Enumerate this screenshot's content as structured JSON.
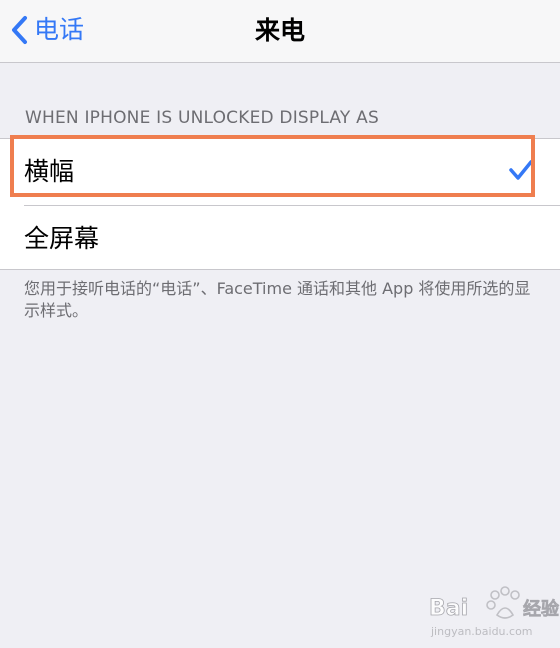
{
  "navbar": {
    "back_label": "电话",
    "title": "来电",
    "back_icon": "chevron-left-icon"
  },
  "section": {
    "header": "WHEN IPHONE IS UNLOCKED DISPLAY AS",
    "options": [
      {
        "label": "横幅",
        "selected": true
      },
      {
        "label": "全屏幕",
        "selected": false
      }
    ],
    "footer": "您用于接听电话的“电话”、FaceTime 通话和其他 App 将使用所选的显示样式。"
  },
  "annotation": {
    "highlight_color": "#ef7e4f"
  },
  "watermark": {
    "text": "Baidu经验",
    "site": "jingyan.baidu.com"
  },
  "colors": {
    "accent": "#3478f6",
    "background": "#efeff4",
    "secondary_text": "#6d6d72"
  }
}
